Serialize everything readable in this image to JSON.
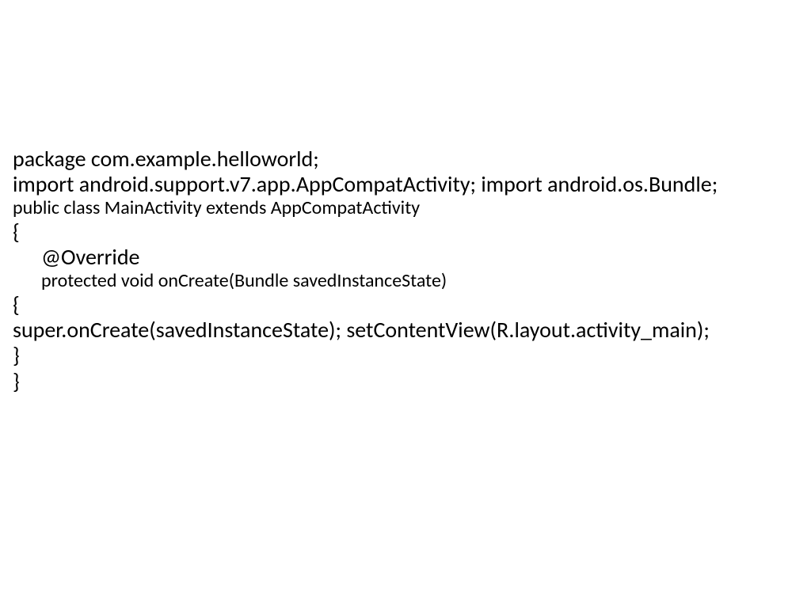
{
  "code": {
    "line1": "package com.example.helloworld;",
    "line2": "import android.support.v7.app.AppCompatActivity; import android.os.Bundle;",
    "line3": "public class MainActivity extends AppCompatActivity",
    "line4": "{",
    "line5": "@Override",
    "line6": "protected void onCreate(Bundle savedInstanceState)",
    "line7": "{",
    "line8": "super.onCreate(savedInstanceState); setContentView(R.layout.activity_main);",
    "line9": " }",
    "line10": "}"
  }
}
